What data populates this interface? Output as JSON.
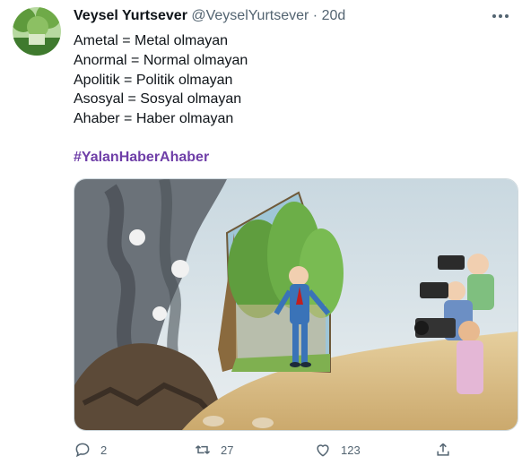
{
  "author": {
    "name": "Veysel Yurtsever",
    "handle": "@VeyselYurtsever",
    "separator": "·",
    "time": "20d"
  },
  "tweet": {
    "lines": [
      "Ametal = Metal olmayan",
      "Anormal = Normal olmayan",
      "Apolitik = Politik olmayan",
      "Asosyal = Sosyal olmayan",
      "Ahaber = Haber olmayan"
    ],
    "hashtag": "#YalanHaberAhaber"
  },
  "actions": {
    "reply_count": "2",
    "retweet_count": "27",
    "like_count": "123"
  },
  "icons": [
    "more-icon",
    "reply-icon",
    "retweet-icon",
    "like-icon",
    "share-icon"
  ],
  "colors": {
    "hashtag": "#6f3fa8",
    "muted": "#536471",
    "text": "#0f1419"
  }
}
